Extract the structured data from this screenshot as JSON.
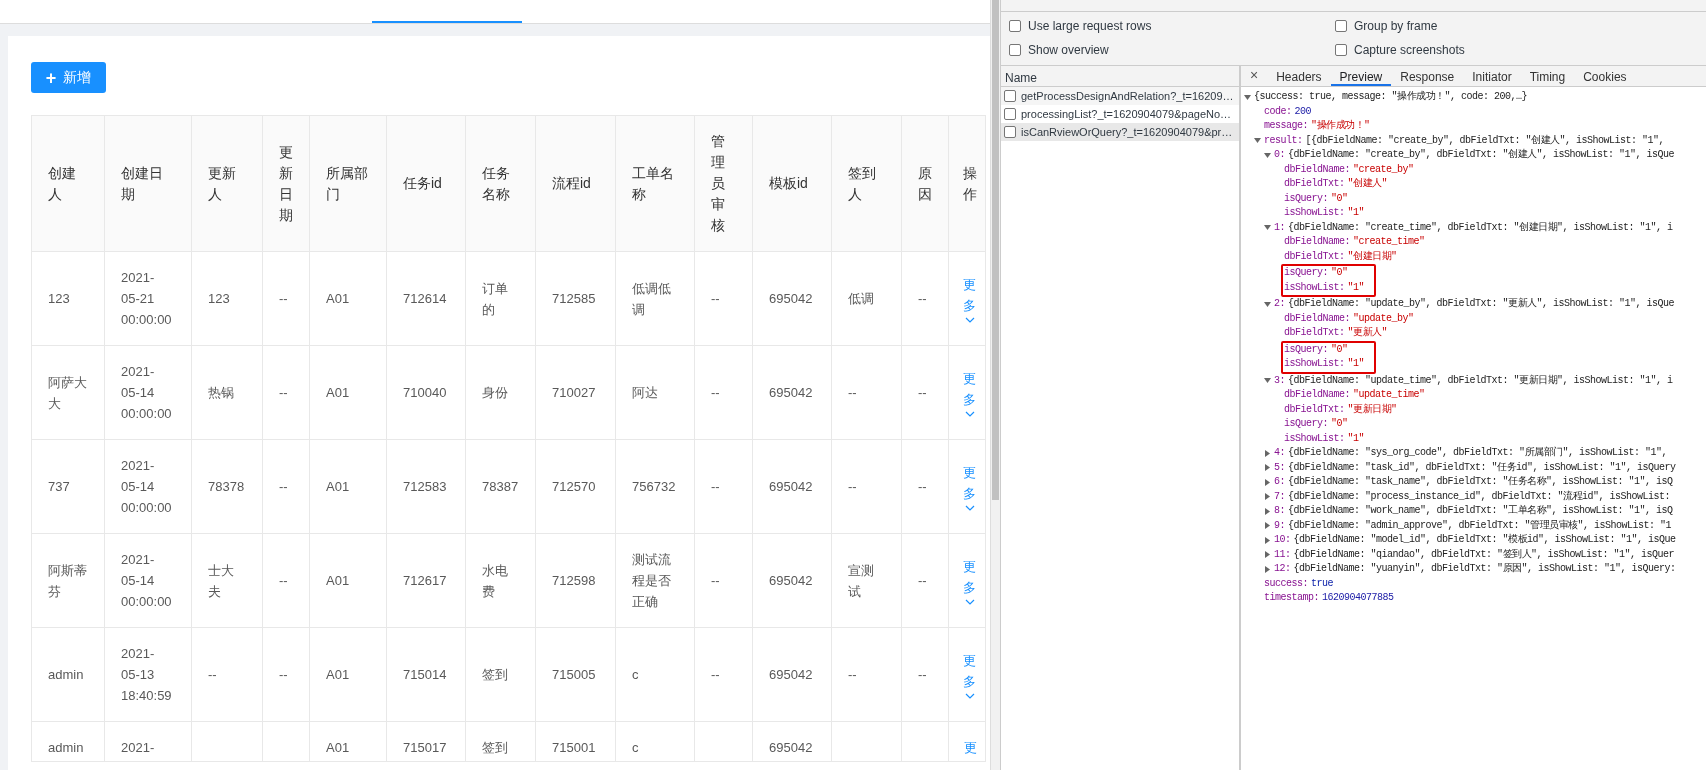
{
  "add_button": {
    "label": "新增",
    "icon": "+"
  },
  "table": {
    "columns": [
      "创建人",
      "创建日期",
      "更新人",
      "更新日期",
      "所属部门",
      "任务id",
      "任务名称",
      "流程id",
      "工单名称",
      "管理员审核",
      "模板id",
      "签到人",
      "原因",
      "操作"
    ],
    "rows": [
      {
        "cells": [
          "123",
          "2021-05-21 00:00:00",
          "123",
          "--",
          "A01",
          "712614",
          "订单的",
          "712585",
          "低调低调",
          "--",
          "695042",
          "低调",
          "--"
        ],
        "action": "更多"
      },
      {
        "cells": [
          "阿萨大大",
          "2021-05-14 00:00:00",
          "热锅",
          "--",
          "A01",
          "710040",
          "身份",
          "710027",
          "阿达",
          "--",
          "695042",
          "--",
          "--"
        ],
        "action": "更多"
      },
      {
        "cells": [
          "737",
          "2021-05-14 00:00:00",
          "78378",
          "--",
          "A01",
          "712583",
          "78387",
          "712570",
          "756732",
          "--",
          "695042",
          "--",
          "--"
        ],
        "action": "更多"
      },
      {
        "cells": [
          "阿斯蒂芬",
          "2021-05-14 00:00:00",
          "士大夫",
          "--",
          "A01",
          "712617",
          "水电费",
          "712598",
          "测试流程是否正确",
          "--",
          "695042",
          "宣测试",
          "--"
        ],
        "action": "更多"
      },
      {
        "cells": [
          "admin",
          "2021-05-13 18:40:59",
          "--",
          "--",
          "A01",
          "715014",
          "签到",
          "715005",
          "c",
          "--",
          "695042",
          "--",
          "--"
        ],
        "action": "更多"
      },
      {
        "cells": [
          "admin",
          "2021-",
          null,
          null,
          "A01",
          "715017",
          "签到",
          "715001",
          "c",
          null,
          "695042",
          null,
          null
        ],
        "action": "更"
      }
    ]
  },
  "devtools": {
    "options": [
      {
        "label": "Use large request rows",
        "checked": false
      },
      {
        "label": "Group by frame",
        "checked": false
      },
      {
        "label": "Show overview",
        "checked": false
      },
      {
        "label": "Capture screenshots",
        "checked": false
      }
    ],
    "name_header": "Name",
    "requests": [
      {
        "name": "getProcessDesignAndRelation?_t=16209…",
        "selected": false
      },
      {
        "name": "processingList?_t=1620904079&pageNo…",
        "selected": false
      },
      {
        "name": "isCanRviewOrQuery?_t=1620904079&pr…",
        "selected": true
      }
    ],
    "close": "×",
    "tabs": [
      {
        "label": "Headers",
        "selected": false
      },
      {
        "label": "Preview",
        "selected": true
      },
      {
        "label": "Response",
        "selected": false
      },
      {
        "label": "Initiator",
        "selected": false
      },
      {
        "label": "Timing",
        "selected": false
      },
      {
        "label": "Cookies",
        "selected": false
      }
    ],
    "tree": {
      "summary": "{success: true, message: \"操作成功！\", code: 200,…}",
      "expanded": true,
      "children": [
        {
          "key": "code:",
          "value": "200",
          "kind": "number"
        },
        {
          "key": "message:",
          "value": "\"操作成功！\"",
          "kind": "string"
        },
        {
          "key": "result:",
          "summary": "[{dbFieldName: \"create_by\", dbFieldTxt: \"创建人\", isShowList: \"1\",",
          "expanded": true,
          "children": [
            {
              "key": "0:",
              "summary": "{dbFieldName: \"create_by\", dbFieldTxt: \"创建人\", isShowList: \"1\", isQue",
              "expanded": true,
              "children": [
                {
                  "key": "dbFieldName:",
                  "value": "\"create_by\"",
                  "kind": "string"
                },
                {
                  "key": "dbFieldTxt:",
                  "value": "\"创建人\"",
                  "kind": "string"
                },
                {
                  "key": "isQuery:",
                  "value": "\"0\"",
                  "kind": "string"
                },
                {
                  "key": "isShowList:",
                  "value": "\"1\"",
                  "kind": "string"
                }
              ]
            },
            {
              "key": "1:",
              "summary": "{dbFieldName: \"create_time\", dbFieldTxt: \"创建日期\", isShowList: \"1\", i",
              "expanded": true,
              "children": [
                {
                  "key": "dbFieldName:",
                  "value": "\"create_time\"",
                  "kind": "string"
                },
                {
                  "key": "dbFieldTxt:",
                  "value": "\"创建日期\"",
                  "kind": "string"
                },
                {
                  "key": "isQuery:",
                  "value": "\"0\"",
                  "kind": "string",
                  "boxed": true
                },
                {
                  "key": "isShowList:",
                  "value": "\"1\"",
                  "kind": "string",
                  "boxed": true
                }
              ]
            },
            {
              "key": "2:",
              "summary": "{dbFieldName: \"update_by\", dbFieldTxt: \"更新人\", isShowList: \"1\", isQue",
              "expanded": true,
              "children": [
                {
                  "key": "dbFieldName:",
                  "value": "\"update_by\"",
                  "kind": "string"
                },
                {
                  "key": "dbFieldTxt:",
                  "value": "\"更新人\"",
                  "kind": "string"
                },
                {
                  "key": "isQuery:",
                  "value": "\"0\"",
                  "kind": "string",
                  "boxed": true
                },
                {
                  "key": "isShowList:",
                  "value": "\"1\"",
                  "kind": "string",
                  "boxed": true
                }
              ]
            },
            {
              "key": "3:",
              "summary": "{dbFieldName: \"update_time\", dbFieldTxt: \"更新日期\", isShowList: \"1\", i",
              "expanded": true,
              "children": [
                {
                  "key": "dbFieldName:",
                  "value": "\"update_time\"",
                  "kind": "string"
                },
                {
                  "key": "dbFieldTxt:",
                  "value": "\"更新日期\"",
                  "kind": "string"
                },
                {
                  "key": "isQuery:",
                  "value": "\"0\"",
                  "kind": "string"
                },
                {
                  "key": "isShowList:",
                  "value": "\"1\"",
                  "kind": "string"
                }
              ]
            },
            {
              "key": "4:",
              "summary": "{dbFieldName: \"sys_org_code\", dbFieldTxt: \"所属部门\", isShowList: \"1\",",
              "expanded": false
            },
            {
              "key": "5:",
              "summary": "{dbFieldName: \"task_id\", dbFieldTxt: \"任务id\", isShowList: \"1\", isQuery",
              "expanded": false
            },
            {
              "key": "6:",
              "summary": "{dbFieldName: \"task_name\", dbFieldTxt: \"任务名称\", isShowList: \"1\", isQ",
              "expanded": false
            },
            {
              "key": "7:",
              "summary": "{dbFieldName: \"process_instance_id\", dbFieldTxt: \"流程id\", isShowList:",
              "expanded": false
            },
            {
              "key": "8:",
              "summary": "{dbFieldName: \"work_name\", dbFieldTxt: \"工单名称\", isShowList: \"1\", isQ",
              "expanded": false
            },
            {
              "key": "9:",
              "summary": "{dbFieldName: \"admin_approve\", dbFieldTxt: \"管理员审核\", isShowList: \"1",
              "expanded": false
            },
            {
              "key": "10:",
              "summary": "{dbFieldName: \"model_id\", dbFieldTxt: \"模板id\", isShowList: \"1\", isQue",
              "expanded": false
            },
            {
              "key": "11:",
              "summary": "{dbFieldName: \"qiandao\", dbFieldTxt: \"签到人\", isShowList: \"1\", isQuer",
              "expanded": false
            },
            {
              "key": "12:",
              "summary": "{dbFieldName: \"yuanyin\", dbFieldTxt: \"原因\", isShowList: \"1\", isQuery:",
              "expanded": false
            }
          ]
        },
        {
          "key": "success:",
          "value": "true",
          "kind": "boolean"
        },
        {
          "key": "timestamp:",
          "value": "1620904077885",
          "kind": "number"
        }
      ]
    }
  }
}
